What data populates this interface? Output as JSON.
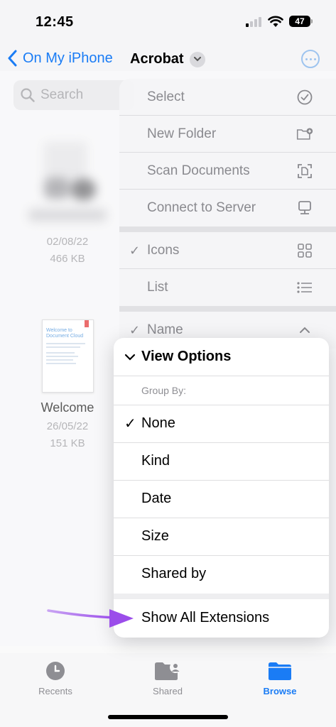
{
  "status_bar": {
    "time": "12:45",
    "battery": "47"
  },
  "nav": {
    "back_label": "On My iPhone",
    "title": "Acrobat"
  },
  "search": {
    "placeholder": "Search"
  },
  "files": [
    {
      "name": "",
      "date": "02/08/22",
      "size": "466 KB"
    },
    {
      "name": "Welcome",
      "date": "26/05/22",
      "size": "151 KB",
      "thumb_title": "Welcome to Document Cloud"
    }
  ],
  "menu": {
    "items": [
      {
        "label": "Select",
        "icon": "checkmark-circle-icon"
      },
      {
        "label": "New Folder",
        "icon": "folder-plus-icon"
      },
      {
        "label": "Scan Documents",
        "icon": "scan-document-icon"
      },
      {
        "label": "Connect to Server",
        "icon": "server-icon"
      },
      {
        "label": "Icons",
        "icon": "grid-icon",
        "checked": true
      },
      {
        "label": "List",
        "icon": "list-icon"
      },
      {
        "label": "Name",
        "icon": "chevron-up-icon",
        "checked": true
      }
    ]
  },
  "submenu": {
    "title": "View Options",
    "group_label": "Group By:",
    "options": [
      "None",
      "Kind",
      "Date",
      "Size",
      "Shared by"
    ],
    "selected": "None",
    "extensions_label": "Show All Extensions"
  },
  "tabbar": {
    "tabs": [
      {
        "label": "Recents",
        "icon": "clock-icon"
      },
      {
        "label": "Shared",
        "icon": "shared-folder-icon"
      },
      {
        "label": "Browse",
        "icon": "folder-icon",
        "active": true
      }
    ]
  },
  "colors": {
    "accent": "#1a7cf5",
    "annotation_arrow": "#9b4dea"
  }
}
